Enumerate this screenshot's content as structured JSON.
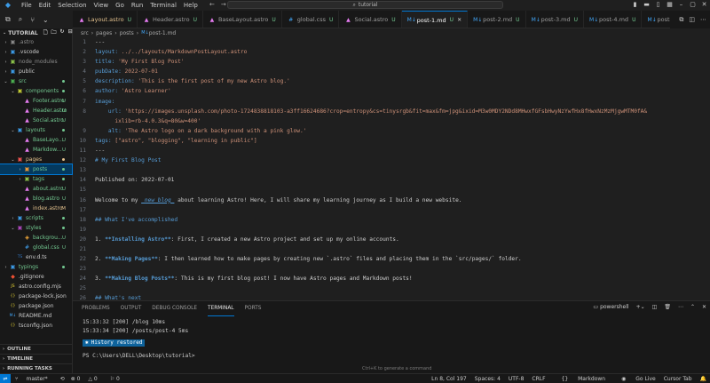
{
  "menu": [
    "File",
    "Edit",
    "Selection",
    "View",
    "Go",
    "Run",
    "Terminal",
    "Help"
  ],
  "search": {
    "text": "tutorial"
  },
  "nav": {
    "back": "←",
    "forward": "→"
  },
  "tabs": [
    {
      "label": "Layout.astro",
      "icon": "astro-icon",
      "status": "U",
      "color": "#e2c08d"
    },
    {
      "label": "Header.astro",
      "icon": "astro-icon",
      "status": "U"
    },
    {
      "label": "BaseLayout.astro",
      "icon": "astro-icon",
      "status": "U"
    },
    {
      "label": "global.css",
      "icon": "css-icon",
      "status": "U"
    },
    {
      "label": "Social.astro",
      "icon": "astro-icon",
      "status": "U"
    },
    {
      "label": "post-1.md",
      "icon": "markdown-icon",
      "status": "U",
      "active": true
    },
    {
      "label": "post-2.md",
      "icon": "markdown-icon",
      "status": "U"
    },
    {
      "label": "post-3.md",
      "icon": "markdown-icon",
      "status": "U"
    },
    {
      "label": "post-4.md",
      "icon": "markdown-icon",
      "status": "U"
    },
    {
      "label": "post-5.m",
      "icon": "markdown-icon",
      "status": ""
    }
  ],
  "explorer": {
    "title": "TUTORIAL",
    "items": [
      {
        "label": ".astro",
        "type": "folder",
        "depth": 0,
        "open": false,
        "dim": true
      },
      {
        "label": ".vscode",
        "type": "folder",
        "depth": 0,
        "open": false
      },
      {
        "label": "node_modules",
        "type": "folder",
        "depth": 0,
        "open": false,
        "dim": true
      },
      {
        "label": "public",
        "type": "folder",
        "depth": 0,
        "open": false
      },
      {
        "label": "src",
        "type": "folder",
        "depth": 0,
        "open": true,
        "git": "u",
        "dot": true
      },
      {
        "label": "components",
        "type": "folder",
        "depth": 1,
        "open": true,
        "git": "u",
        "dot": true
      },
      {
        "label": "Footer.astro",
        "type": "astro",
        "depth": 2,
        "git": "u",
        "badge": "U"
      },
      {
        "label": "Header.astro",
        "type": "astro",
        "depth": 2,
        "git": "u",
        "badge": "U"
      },
      {
        "label": "Social.astro",
        "type": "astro",
        "depth": 2,
        "git": "u",
        "badge": "U"
      },
      {
        "label": "layouts",
        "type": "folder",
        "depth": 1,
        "open": true,
        "git": "u",
        "dot": true
      },
      {
        "label": "BaseLayo...",
        "type": "astro",
        "depth": 2,
        "git": "u",
        "badge": "U"
      },
      {
        "label": "Markdow...",
        "type": "astro",
        "depth": 2,
        "git": "u",
        "badge": "U"
      },
      {
        "label": "pages",
        "type": "folder",
        "depth": 1,
        "open": true,
        "git": "m",
        "dot": true
      },
      {
        "label": "posts",
        "type": "folder",
        "depth": 2,
        "open": false,
        "git": "u",
        "dot": true,
        "selected": true
      },
      {
        "label": "tags",
        "type": "folder",
        "depth": 2,
        "open": false,
        "git": "u",
        "dot": true
      },
      {
        "label": "about.astro",
        "type": "astro",
        "depth": 2,
        "git": "u",
        "badge": "U"
      },
      {
        "label": "blog.astro",
        "type": "astro",
        "depth": 2,
        "git": "u",
        "badge": "U"
      },
      {
        "label": "index.astro",
        "type": "astro",
        "depth": 2,
        "git": "m",
        "badge": "M"
      },
      {
        "label": "scripts",
        "type": "folder",
        "depth": 1,
        "open": false,
        "git": "u",
        "dot": true
      },
      {
        "label": "styles",
        "type": "folder",
        "depth": 1,
        "open": true,
        "git": "u",
        "dot": true
      },
      {
        "label": "backgrou...",
        "type": "svg",
        "depth": 2,
        "git": "u",
        "badge": "U"
      },
      {
        "label": "global.css",
        "type": "css",
        "depth": 2,
        "git": "u",
        "badge": "U"
      },
      {
        "label": "env.d.ts",
        "type": "ts",
        "depth": 1
      },
      {
        "label": "typings",
        "type": "folder",
        "depth": 0,
        "open": false,
        "git": "u",
        "dot": true
      },
      {
        "label": ".gitignore",
        "type": "git",
        "depth": 0
      },
      {
        "label": "astro.config.mjs",
        "type": "js",
        "depth": 0
      },
      {
        "label": "package-lock.json",
        "type": "json",
        "depth": 0
      },
      {
        "label": "package.json",
        "type": "json",
        "depth": 0
      },
      {
        "label": "README.md",
        "type": "md",
        "depth": 0
      },
      {
        "label": "tsconfig.json",
        "type": "json",
        "depth": 0
      }
    ],
    "sections": [
      "OUTLINE",
      "TIMELINE",
      "RUNNING TASKS"
    ]
  },
  "breadcrumb": [
    "src",
    "pages",
    "posts",
    "post-1.md"
  ],
  "editor": {
    "lines": [
      {
        "n": "1",
        "t": "---"
      },
      {
        "n": "2",
        "k": "layout:",
        "v": " ../../layouts/MarkdownPostLayout.astro"
      },
      {
        "n": "3",
        "k": "title:",
        "v": " 'My First Blog Post'"
      },
      {
        "n": "4",
        "k": "pubDate:",
        "v": " 2022-07-01"
      },
      {
        "n": "5",
        "k": "description:",
        "v": " 'This is the first post of my new Astro blog.'"
      },
      {
        "n": "6",
        "k": "author:",
        "v": " 'Astro Learner'"
      },
      {
        "n": "7",
        "k": "image:",
        "v": ""
      },
      {
        "n": "8",
        "k": "    url:",
        "v": " 'https://images.unsplash.com/photo-1724838818103-a3ff16624686?crop=entropy&cs=tinysrgb&fit=max&fm=jpg&ixid=M3w0MDY2NDd8MHwxfGFsbHwyNzYwfHx8fHwxNzMzMjgwMTM0fA&"
      },
      {
        "n": "",
        "k": "",
        "v": "      ixlib=rb-4.0.3&q=80&w=400'"
      },
      {
        "n": "9",
        "k": "    alt:",
        "v": " 'The Astro logo on a dark background with a pink glow.'"
      },
      {
        "n": "10",
        "k": "tags:",
        "v": " [\"astro\", \"blogging\", \"learning in public\"]"
      },
      {
        "n": "11",
        "t": "---"
      },
      {
        "n": "12",
        "h": "# My First Blog Post"
      },
      {
        "n": "13",
        "t": ""
      },
      {
        "n": "14",
        "t": "Published on: 2022-07-01"
      },
      {
        "n": "15",
        "t": ""
      },
      {
        "n": "16",
        "pre": "Welcome to my ",
        "ital": "_new blog_",
        "post": " about learning Astro! Here, I will share my learning journey as I build a new website."
      },
      {
        "n": "17",
        "t": ""
      },
      {
        "n": "18",
        "h": "## What I've accomplished"
      },
      {
        "n": "19",
        "t": ""
      },
      {
        "n": "20",
        "pre": "1. ",
        "bold": "**Installing Astro**",
        "post": ": First, I created a new Astro project and set up my online accounts."
      },
      {
        "n": "21",
        "t": ""
      },
      {
        "n": "22",
        "pre": "2. ",
        "bold": "**Making Pages**",
        "post": ": I then learned how to make pages by creating new `.astro` files and placing them in the `src/pages/` folder."
      },
      {
        "n": "23",
        "t": ""
      },
      {
        "n": "24",
        "pre": "3. ",
        "bold": "**Making Blog Posts**",
        "post": ": This is my first blog post! I now have Astro pages and Markdown posts!"
      },
      {
        "n": "25",
        "t": ""
      },
      {
        "n": "26",
        "h": "## What's next"
      },
      {
        "n": "27",
        "t": ""
      },
      {
        "n": "28",
        "t": "I will finish the Astro tutorial, and then keep adding more posts. Watch this space for more to come."
      },
      {
        "n": "29",
        "t": ""
      }
    ]
  },
  "panel": {
    "tabs": [
      "PROBLEMS",
      "OUTPUT",
      "DEBUG CONSOLE",
      "TERMINAL",
      "PORTS"
    ],
    "active": "TERMINAL",
    "shell": "powershell",
    "terminal": [
      "15:33:32 [200] /blog 10ms",
      "15:33:34 [200] /posts/post-4 5ms"
    ],
    "restored": "History restored",
    "prompt": "PS C:\\Users\\DELL\\Desktop\\tutorial>",
    "hint": "Ctrl+K to generate a command"
  },
  "status": {
    "branch": "master*",
    "errors": "0",
    "warnings": "0",
    "problems": "0",
    "position": "Ln 8, Col 197",
    "spaces": "Spaces: 4",
    "encoding": "UTF-8",
    "eol": "CRLF",
    "language": "Markdown",
    "golive": "Go Live",
    "tab": "Cursor Tab"
  },
  "colors": {
    "accent": "#0078d4",
    "untracked": "#73c991",
    "modified": "#e2c08d"
  }
}
